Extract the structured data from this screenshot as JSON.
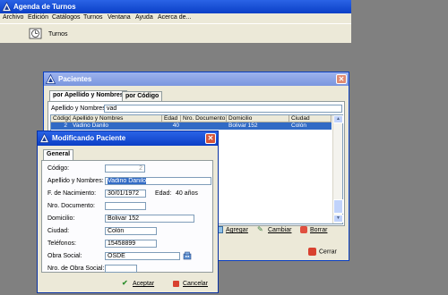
{
  "app": {
    "title": "Agenda de Turnos"
  },
  "menu": [
    "Archivo",
    "Edición",
    "Catálogos",
    "Turnos",
    "Ventana",
    "Ayuda",
    "Acerca de..."
  ],
  "toolbar": {
    "turnos_label": "Turnos"
  },
  "pacientes": {
    "title": "Pacientes",
    "tabs": [
      "por Apellido y Nombres",
      "por Código"
    ],
    "search_label": "Apellido y Nombres:",
    "search_value": "vad",
    "columns": [
      "Código",
      "Apellido y Nombres",
      "Edad",
      "Nro. Documento",
      "Domicilio",
      "Ciudad"
    ],
    "rows": [
      {
        "codigo": "2",
        "nombre": "Vadino Danilo",
        "edad": "40",
        "documento": "",
        "domicilio": "Bolivar 152",
        "ciudad": "Colón"
      }
    ],
    "buttons": {
      "agregar": "Agregar",
      "cambiar": "Cambiar",
      "borrar": "Borrar",
      "cerrar": "Cerrar"
    }
  },
  "modificando": {
    "title": "Modificando Paciente",
    "tab": "General",
    "fields": {
      "codigo": {
        "label": "Código:",
        "value": "2"
      },
      "nombre": {
        "label": "Apellido y Nombres:",
        "value": "Vadino Danilo"
      },
      "nacimiento": {
        "label": "F. de Nacimiento:",
        "value": "30/01/1972"
      },
      "edad": {
        "label": "Edad:",
        "value": "40 años"
      },
      "documento": {
        "label": "Nro. Documento:",
        "value": ""
      },
      "domicilio": {
        "label": "Domicilio:",
        "value": "Bolivar 152"
      },
      "ciudad": {
        "label": "Ciudad:",
        "value": "Colón"
      },
      "telefonos": {
        "label": "Teléfonos:",
        "value": "15458899"
      },
      "obra_social": {
        "label": "Obra Social:",
        "value": "OSDE"
      },
      "nro_obra_social": {
        "label": "Nro. de Obra Social:",
        "value": ""
      }
    },
    "buttons": {
      "aceptar": "Aceptar",
      "cancelar": "Cancelar"
    }
  },
  "colors": {
    "title_blue": "#0A3FC0",
    "inactive_title": "#7A96DF",
    "selection": "#316AC5",
    "workspace": "#808080",
    "window_face": "#ECE9D8"
  }
}
